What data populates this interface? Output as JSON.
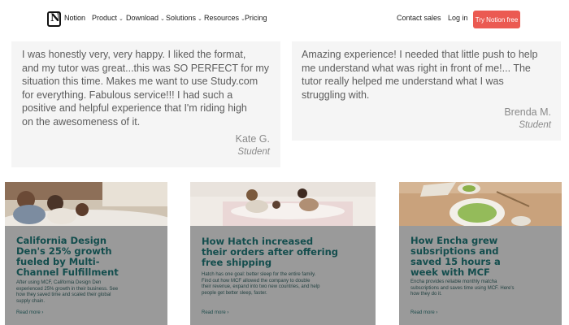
{
  "nav": {
    "brand": "Notion",
    "items": [
      {
        "label": "Product",
        "chevron": "⌄"
      },
      {
        "label": "Download",
        "chevron": "⌄"
      },
      {
        "label": "Solutions",
        "chevron": "⌄"
      },
      {
        "label": "Resources",
        "chevron": "⌄"
      },
      {
        "label": "Pricing",
        "chevron": ""
      }
    ],
    "contact": "Contact sales",
    "login": "Log in",
    "cta": "Try Notion free",
    "cta_color": "#eb5a52"
  },
  "testimonials": [
    {
      "lines": [
        "I was honestly very, very happy. I liked the format,",
        "and my tutor was great...this was SO PERFECT for my",
        "situation this time. Makes me want to use Study.com",
        "for everything. Fabulous service!!! I had such a",
        "positive and helpful experience that I'm riding high",
        "on the awesomeness of it."
      ],
      "name": "Kate G.",
      "role": "Student"
    },
    {
      "lines": [
        "Amazing experience! I needed that little push to help",
        "me understand what was right in front of me!... The",
        "tutor really helped me understand what I was",
        "struggling with."
      ],
      "name": "Brenda M.",
      "role": "Student"
    }
  ],
  "cards": [
    {
      "title_lines": [
        "California Design",
        "Den's 25% growth",
        "fueled by Multi-",
        "Channel Fulfillment"
      ],
      "desc_lines": [
        "After using MCF, California Design Den",
        "experienced 25% growth in their business. See",
        "how they saved time and scaled their global",
        "supply chain."
      ],
      "link": "Read more ›"
    },
    {
      "title_lines": [
        "How Hatch increased",
        "their orders after offering",
        "free shipping"
      ],
      "desc_lines": [
        "Hatch has one goal: better sleep for the entire family.",
        "Find out how MCF allowed the company to double",
        "their revenue, expand into two new countries, and help",
        "people get better sleep, faster."
      ],
      "link": "Read more ›"
    },
    {
      "title_lines": [
        "How Encha grew",
        "subsriptions and",
        "saved 15 hours a",
        "week with MCF"
      ],
      "desc_lines": [
        "Encha provides reliable monthly matcha",
        "subscriptions and saves time using MCF. Here's",
        "how they do it."
      ],
      "link": "Read more ›"
    }
  ]
}
